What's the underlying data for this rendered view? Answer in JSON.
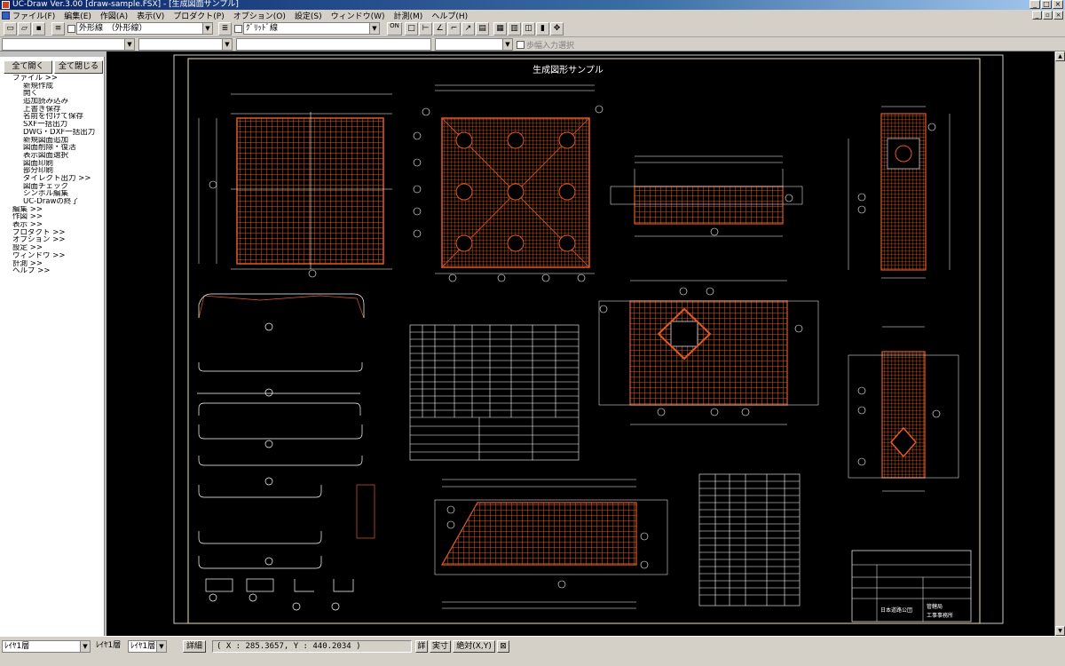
{
  "window": {
    "title": "UC-Draw Ver.3.00 [draw-sample.FSX] - [生成図面サンプル]"
  },
  "menu": [
    "ファイル(F)",
    "編集(E)",
    "作図(A)",
    "表示(V)",
    "プロダクト(P)",
    "オプション(O)",
    "設定(S)",
    "ウィンドウ(W)",
    "計測(M)",
    "ヘルプ(H)"
  ],
  "toolbar": {
    "layer_combo": "外形線　（外形線）",
    "line_combo": "ｸﾞﾘｯﾄﾞ線",
    "on_button": "ON",
    "step_label": "歩幅入力選択"
  },
  "sidebar": {
    "expand_all": "全て開く",
    "collapse_all": "全て閉じる",
    "tree": [
      {
        "level": 1,
        "label": "ファイル >>"
      },
      {
        "level": 2,
        "label": "新規作成"
      },
      {
        "level": 2,
        "label": "開く"
      },
      {
        "level": 2,
        "label": "追加読み込み"
      },
      {
        "level": 2,
        "label": "上書き保存"
      },
      {
        "level": 2,
        "label": "名前を付けて保存"
      },
      {
        "level": 2,
        "label": "SXF一括出力"
      },
      {
        "level": 2,
        "label": "DWG・DXF一括出力"
      },
      {
        "level": 2,
        "label": "新規図面追加"
      },
      {
        "level": 2,
        "label": "図面削除・復活"
      },
      {
        "level": 2,
        "label": "表示図面選択"
      },
      {
        "level": 2,
        "label": "図面印刷"
      },
      {
        "level": 2,
        "label": "部分印刷"
      },
      {
        "level": 2,
        "label": "ダイレクト出力 >>"
      },
      {
        "level": 2,
        "label": "図面チェック"
      },
      {
        "level": 2,
        "label": "シンボル編集"
      },
      {
        "level": 2,
        "label": "UC-Drawの終了"
      },
      {
        "level": 1,
        "label": "編集 >>"
      },
      {
        "level": 1,
        "label": "作図 >>"
      },
      {
        "level": 1,
        "label": "表示 >>"
      },
      {
        "level": 1,
        "label": "プロダクト >>"
      },
      {
        "level": 1,
        "label": "オプション >>"
      },
      {
        "level": 1,
        "label": "設定 >>"
      },
      {
        "level": 1,
        "label": "ウィンドウ >>"
      },
      {
        "level": 1,
        "label": "計測 >>"
      },
      {
        "level": 1,
        "label": "ヘルプ >>"
      }
    ]
  },
  "drawing": {
    "title": "生成図形サンプル",
    "titleblock": {
      "owner": "日本道路公団",
      "office1": "管轄局",
      "office2": "工事事務所"
    }
  },
  "statusbar": {
    "layer1": "ﾚｲﾔ1層",
    "layer2": "ﾚｲﾔ1層",
    "layer3": "ﾚｲﾔ1層",
    "detail": "詳細",
    "coords": "( X : 285.3657, Y : 440.2034 )",
    "btn_detail2": "詳",
    "btn_actual": "実寸",
    "btn_absolute": "絶対(X,Y)"
  },
  "colors": {
    "rebar": "#e05a28",
    "frame": "#f4e3b0",
    "line": "#ffffff"
  }
}
